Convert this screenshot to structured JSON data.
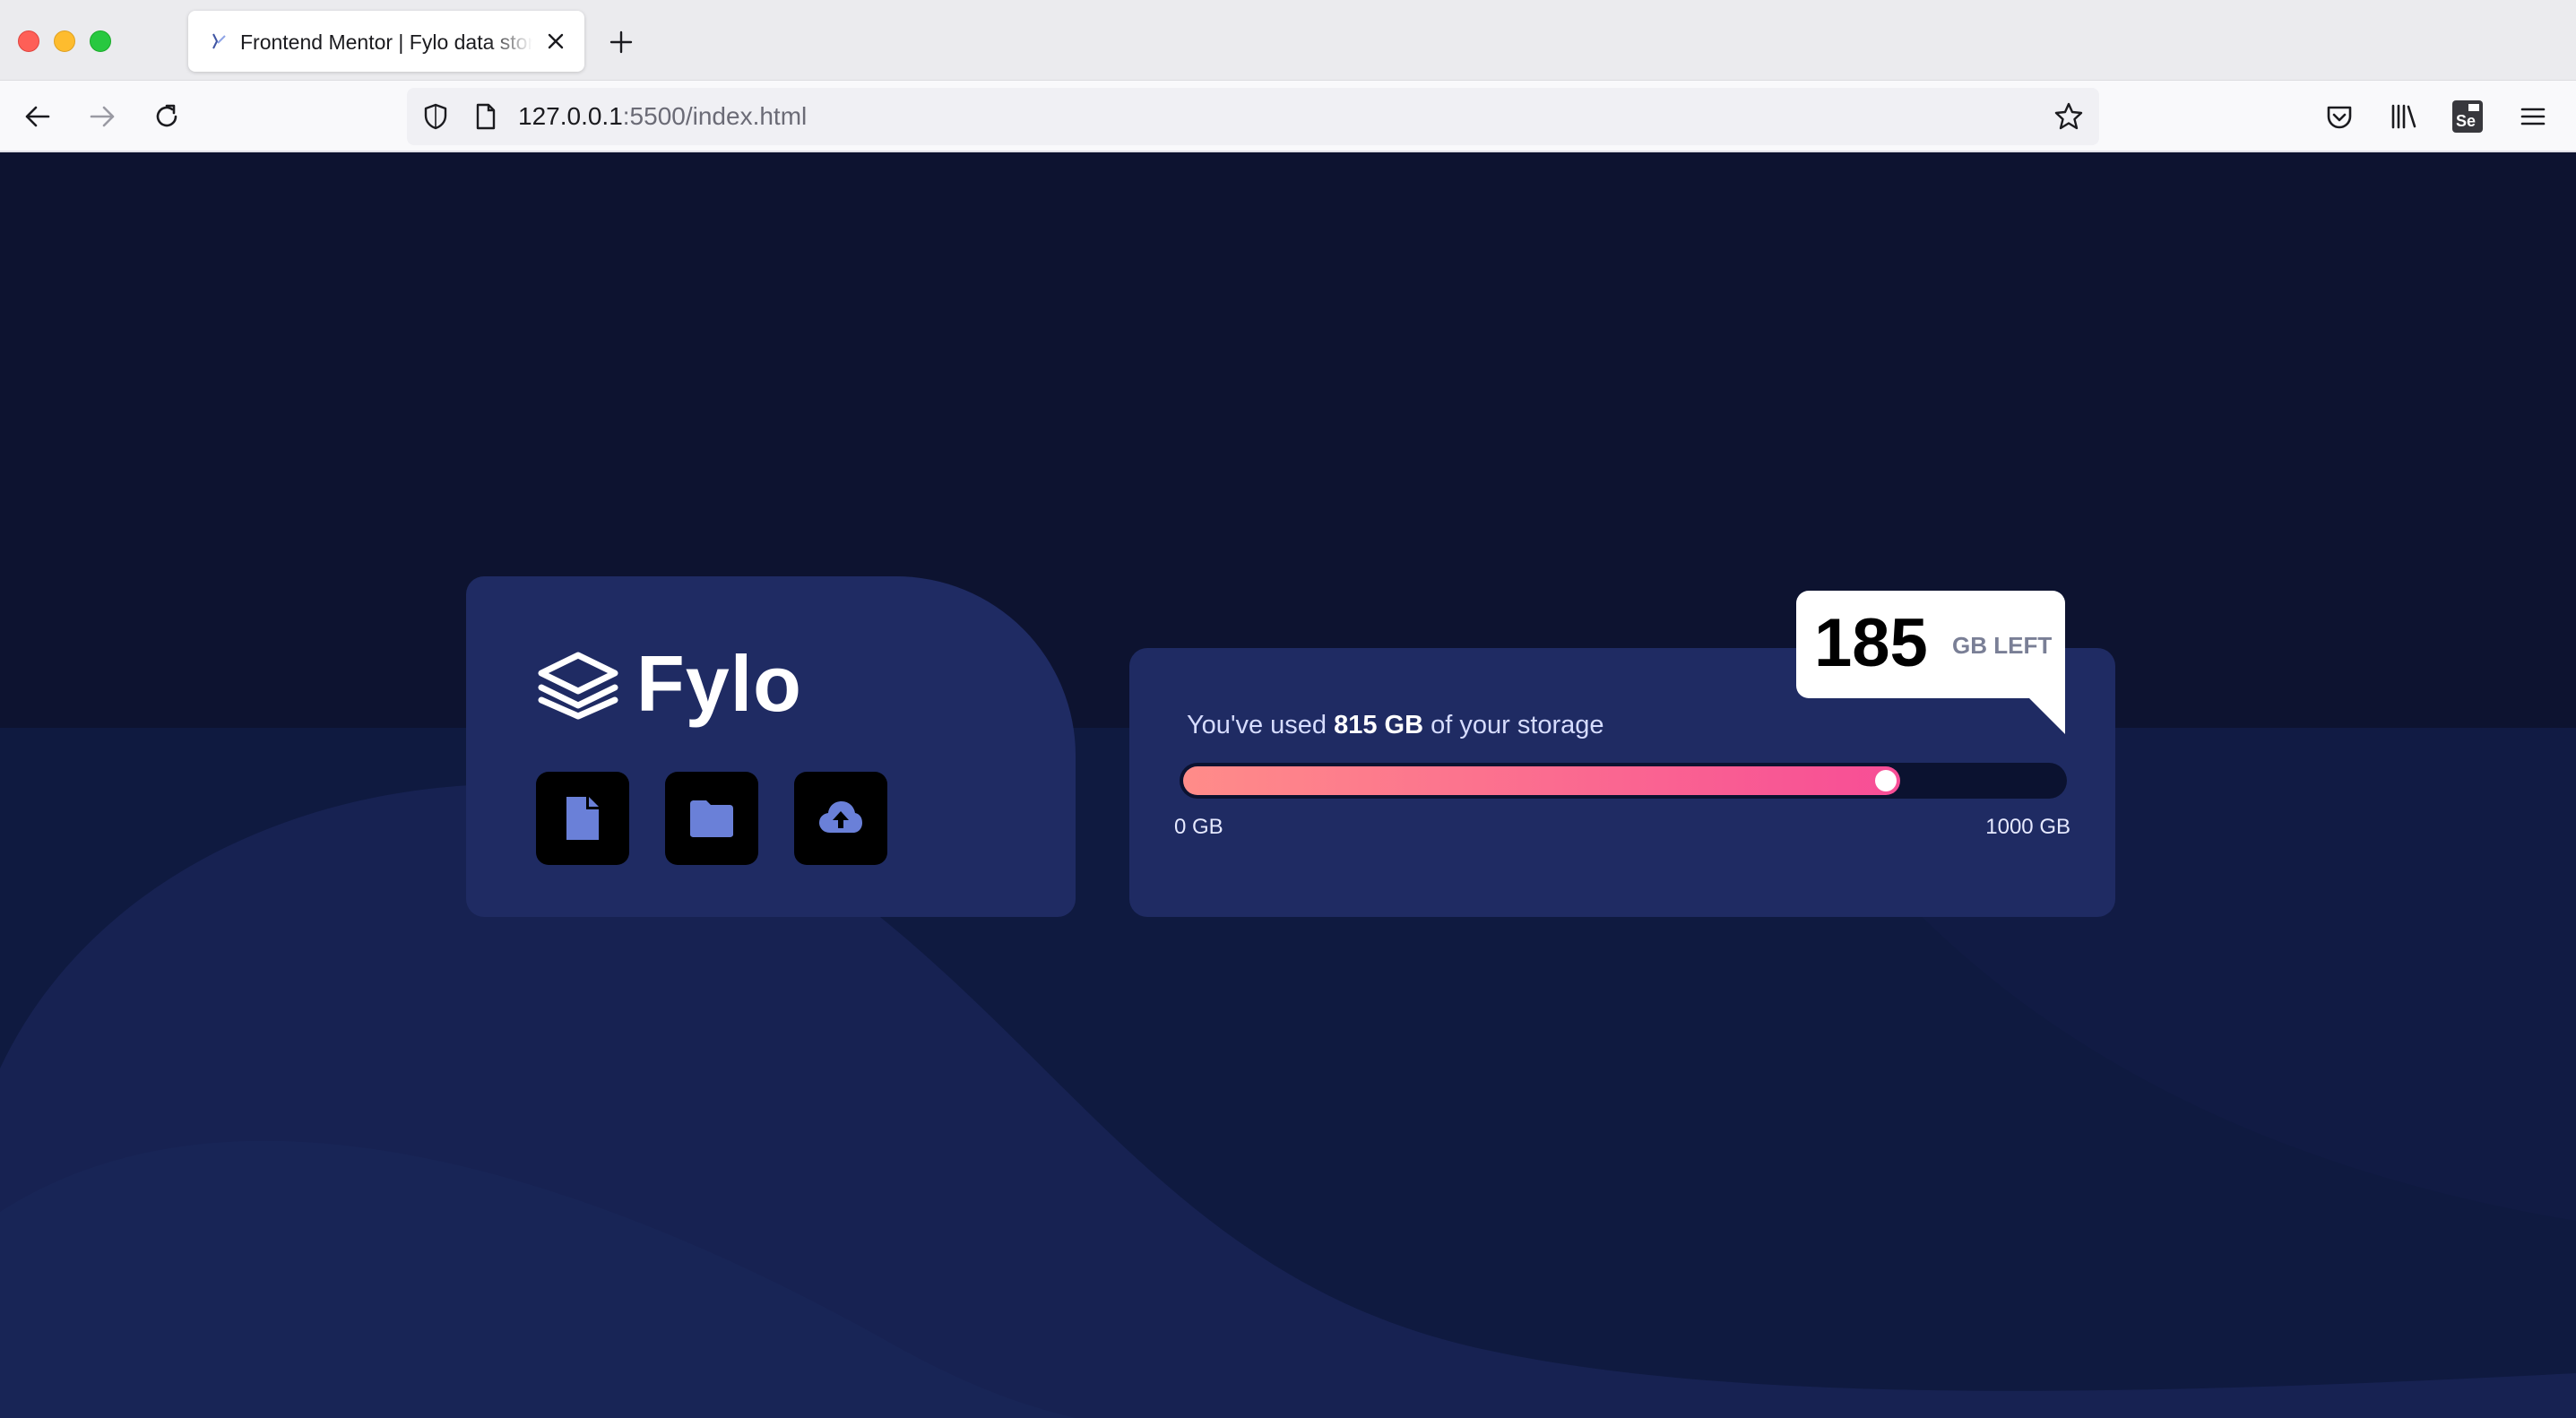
{
  "browser": {
    "tab_title": "Frontend Mentor | Fylo data storage component",
    "url_host": "127.0.0.1",
    "url_rest": ":5500/index.html",
    "icons": [
      "back-arrow-icon",
      "forward-arrow-icon",
      "reload-icon",
      "shield-icon",
      "page-icon",
      "bookmark-star-icon",
      "pocket-icon",
      "library-icon",
      "selenium-extension-icon",
      "menu-icon"
    ]
  },
  "app": {
    "brand": "Fylo",
    "actions": [
      {
        "name": "file",
        "icon": "document-icon"
      },
      {
        "name": "folder",
        "icon": "folder-icon"
      },
      {
        "name": "upload",
        "icon": "cloud-upload-icon"
      }
    ],
    "usage": {
      "prefix": "You've used ",
      "used": "815 GB",
      "suffix": " of your storage",
      "min_label": "0 GB",
      "max_label": "1000 GB",
      "used_fraction": 0.815
    },
    "remaining": {
      "value": "185",
      "unit": "GB LEFT"
    },
    "colors": {
      "background": "#0d1330",
      "card": "#1f2b63",
      "icon_accent": "#6a80d8",
      "gradient_start": "#ff8c89",
      "gradient_end": "#f74d96"
    }
  }
}
